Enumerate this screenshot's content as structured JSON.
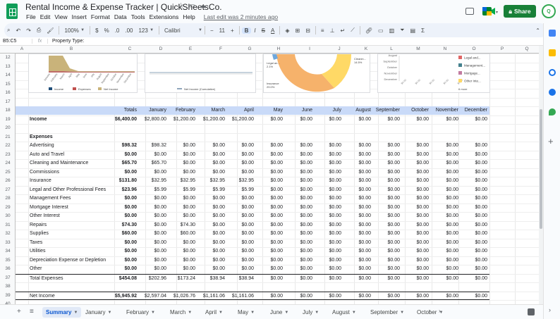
{
  "app": {
    "title": "Rental Income & Expense Tracker | QuickSheetsCo.",
    "menus": [
      "File",
      "Edit",
      "View",
      "Insert",
      "Format",
      "Data",
      "Tools",
      "Extensions",
      "Help"
    ],
    "last_edit": "Last edit was 2 minutes ago",
    "share_label": "Share",
    "avatar_label": "Q"
  },
  "toolbar": {
    "zoom": "100%",
    "currency": "$",
    "percent": "%",
    "dec_minus": ".0",
    "dec_plus": ".00",
    "number_format": "123",
    "font": "Calibri",
    "font_size": "11",
    "bold": "B",
    "italic": "I",
    "strike": "S",
    "text_color": "A"
  },
  "formula_bar": {
    "name_box": "B5:C5",
    "fx": "fx",
    "content": "Property Type:"
  },
  "columns": [
    "A",
    "B",
    "C",
    "D",
    "E",
    "F",
    "G",
    "H",
    "I",
    "J",
    "K",
    "L",
    "M",
    "N",
    "O",
    "P",
    "Q"
  ],
  "rows": [
    "12",
    "13",
    "14",
    "15",
    "16",
    "17",
    "18",
    "19",
    "20",
    "21",
    "22",
    "23",
    "24",
    "25",
    "26",
    "27",
    "28",
    "29",
    "30",
    "31",
    "32",
    "33",
    "34",
    "35",
    "36",
    "37",
    "38",
    "39",
    "40"
  ],
  "chart1": {
    "months": [
      "January",
      "February",
      "March",
      "April",
      "May",
      "June",
      "July",
      "August",
      "September",
      "October",
      "November",
      "December"
    ],
    "legend": [
      "Income",
      "Expenses",
      "Net Income"
    ],
    "colors": [
      "#1f4e79",
      "#c0504d",
      "#c9b37a"
    ]
  },
  "chart2": {
    "legend": [
      "Net Income (Cumulative)"
    ],
    "color": "#1f4e79"
  },
  "chart3": {
    "labels": [
      "Legal an...",
      "Insurance",
      "Cleanin..."
    ],
    "pct_labels": [
      "2.1%",
      "29.0%",
      "14.5%"
    ],
    "colors": [
      "#f6b26b",
      "#ffd966",
      "#6fa8dc",
      "#93c47d"
    ]
  },
  "chart4": {
    "months": [
      "August",
      "September",
      "October",
      "November",
      "December"
    ],
    "legend": [
      "Legal and...",
      "Management...",
      "Mortgage...",
      "Other Inte..."
    ],
    "colors": [
      "#e06666",
      "#45818e",
      "#c27ba0",
      "#ffd966"
    ],
    "more": "6 more"
  },
  "table": {
    "header": [
      "",
      "Totals",
      "January",
      "February",
      "March",
      "April",
      "May",
      "June",
      "July",
      "August",
      "September",
      "October",
      "November",
      "December"
    ],
    "income": {
      "label": "Income",
      "values": [
        "$6,400.00",
        "$2,800.00",
        "$1,200.00",
        "$1,200.00",
        "$1,200.00",
        "$0.00",
        "$0.00",
        "$0.00",
        "$0.00",
        "$0.00",
        "$0.00",
        "$0.00",
        "$0.00"
      ]
    },
    "expenses_label": "Expenses",
    "expenses": [
      {
        "label": "Advertising",
        "values": [
          "$98.32",
          "$98.32",
          "$0.00",
          "$0.00",
          "$0.00",
          "$0.00",
          "$0.00",
          "$0.00",
          "$0.00",
          "$0.00",
          "$0.00",
          "$0.00",
          "$0.00"
        ]
      },
      {
        "label": "Auto and Travel",
        "values": [
          "$0.00",
          "$0.00",
          "$0.00",
          "$0.00",
          "$0.00",
          "$0.00",
          "$0.00",
          "$0.00",
          "$0.00",
          "$0.00",
          "$0.00",
          "$0.00",
          "$0.00"
        ]
      },
      {
        "label": "Cleaning and Maintenance",
        "values": [
          "$65.70",
          "$65.70",
          "$0.00",
          "$0.00",
          "$0.00",
          "$0.00",
          "$0.00",
          "$0.00",
          "$0.00",
          "$0.00",
          "$0.00",
          "$0.00",
          "$0.00"
        ]
      },
      {
        "label": "Commissions",
        "values": [
          "$0.00",
          "$0.00",
          "$0.00",
          "$0.00",
          "$0.00",
          "$0.00",
          "$0.00",
          "$0.00",
          "$0.00",
          "$0.00",
          "$0.00",
          "$0.00",
          "$0.00"
        ]
      },
      {
        "label": "Insurance",
        "values": [
          "$131.80",
          "$32.95",
          "$32.95",
          "$32.95",
          "$32.95",
          "$0.00",
          "$0.00",
          "$0.00",
          "$0.00",
          "$0.00",
          "$0.00",
          "$0.00",
          "$0.00"
        ]
      },
      {
        "label": "Legal and Other Professional Fees",
        "values": [
          "$23.96",
          "$5.99",
          "$5.99",
          "$5.99",
          "$5.99",
          "$0.00",
          "$0.00",
          "$0.00",
          "$0.00",
          "$0.00",
          "$0.00",
          "$0.00",
          "$0.00"
        ]
      },
      {
        "label": "Management Fees",
        "values": [
          "$0.00",
          "$0.00",
          "$0.00",
          "$0.00",
          "$0.00",
          "$0.00",
          "$0.00",
          "$0.00",
          "$0.00",
          "$0.00",
          "$0.00",
          "$0.00",
          "$0.00"
        ]
      },
      {
        "label": "Mortgage Interest",
        "values": [
          "$0.00",
          "$0.00",
          "$0.00",
          "$0.00",
          "$0.00",
          "$0.00",
          "$0.00",
          "$0.00",
          "$0.00",
          "$0.00",
          "$0.00",
          "$0.00",
          "$0.00"
        ]
      },
      {
        "label": "Other Interest",
        "values": [
          "$0.00",
          "$0.00",
          "$0.00",
          "$0.00",
          "$0.00",
          "$0.00",
          "$0.00",
          "$0.00",
          "$0.00",
          "$0.00",
          "$0.00",
          "$0.00",
          "$0.00"
        ]
      },
      {
        "label": "Repairs",
        "values": [
          "$74.30",
          "$0.00",
          "$74.30",
          "$0.00",
          "$0.00",
          "$0.00",
          "$0.00",
          "$0.00",
          "$0.00",
          "$0.00",
          "$0.00",
          "$0.00",
          "$0.00"
        ]
      },
      {
        "label": "Supplies",
        "values": [
          "$60.00",
          "$0.00",
          "$60.00",
          "$0.00",
          "$0.00",
          "$0.00",
          "$0.00",
          "$0.00",
          "$0.00",
          "$0.00",
          "$0.00",
          "$0.00",
          "$0.00"
        ]
      },
      {
        "label": "Taxes",
        "values": [
          "$0.00",
          "$0.00",
          "$0.00",
          "$0.00",
          "$0.00",
          "$0.00",
          "$0.00",
          "$0.00",
          "$0.00",
          "$0.00",
          "$0.00",
          "$0.00",
          "$0.00"
        ]
      },
      {
        "label": "Utilities",
        "values": [
          "$0.00",
          "$0.00",
          "$0.00",
          "$0.00",
          "$0.00",
          "$0.00",
          "$0.00",
          "$0.00",
          "$0.00",
          "$0.00",
          "$0.00",
          "$0.00",
          "$0.00"
        ]
      },
      {
        "label": "Depreciation Expense or Depletion",
        "values": [
          "$0.00",
          "$0.00",
          "$0.00",
          "$0.00",
          "$0.00",
          "$0.00",
          "$0.00",
          "$0.00",
          "$0.00",
          "$0.00",
          "$0.00",
          "$0.00",
          "$0.00"
        ]
      },
      {
        "label": "Other",
        "values": [
          "$0.00",
          "$0.00",
          "$0.00",
          "$0.00",
          "$0.00",
          "$0.00",
          "$0.00",
          "$0.00",
          "$0.00",
          "$0.00",
          "$0.00",
          "$0.00",
          "$0.00"
        ]
      }
    ],
    "total_expenses": {
      "label": "Total Expenses",
      "values": [
        "$454.08",
        "$202.96",
        "$173.24",
        "$38.94",
        "$38.94",
        "$0.00",
        "$0.00",
        "$0.00",
        "$0.00",
        "$0.00",
        "$0.00",
        "$0.00",
        "$0.00"
      ]
    },
    "net_income": {
      "label": "Net Income",
      "values": [
        "$5,945.92",
        "$2,597.04",
        "$1,026.76",
        "$1,161.06",
        "$1,161.06",
        "$0.00",
        "$0.00",
        "$0.00",
        "$0.00",
        "$0.00",
        "$0.00",
        "$0.00",
        "$0.00"
      ]
    }
  },
  "sheet_tabs": [
    "Summary",
    "January",
    "February",
    "March",
    "April",
    "May",
    "June",
    "July",
    "August",
    "September",
    "October"
  ],
  "active_tab": "Summary"
}
